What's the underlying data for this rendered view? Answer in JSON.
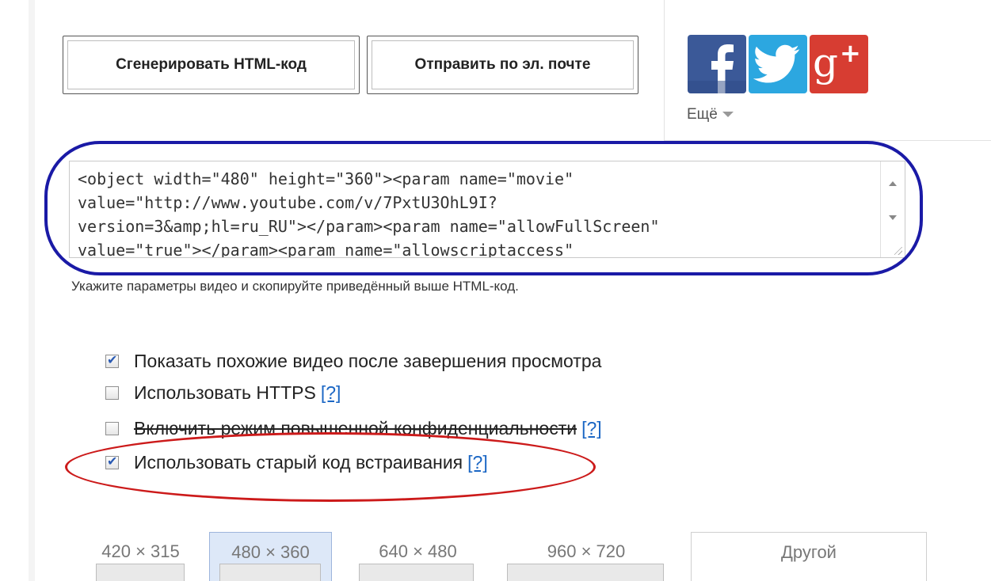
{
  "buttons": {
    "generate": "Сгенерировать HTML-код",
    "email": "Отправить по эл. почте"
  },
  "social": {
    "facebook": "facebook-icon",
    "twitter": "twitter-icon",
    "googleplus": "google-plus-icon",
    "more": "Ещё"
  },
  "code": {
    "line1_a": "<object width=\"480\" height=\"360\"><param name=\"movie\"",
    "line2": "value=\"http://www.youtube.com/v/7PxtU3OhL9I?",
    "line3": "version=3&amp;hl=ru_RU\"></param><param name=\"allowFullScreen\"",
    "line4": "value=\"true\"></param><param name=\"allowscriptaccess\""
  },
  "hint": "Укажите параметры видео и скопируйте приведённый выше HTML-код.",
  "options": [
    {
      "label": "Показать похожие видео после завершения просмотра",
      "checked": true
    },
    {
      "label": "Использовать HTTPS",
      "help": "[?]",
      "checked": false
    },
    {
      "label": "Включить режим повышенной конфиденциальности",
      "help": "[?]",
      "checked": false
    },
    {
      "label": "Использовать старый код встраивания",
      "help": "[?]",
      "checked": true
    }
  ],
  "sizes": [
    {
      "label": "420 × 315"
    },
    {
      "label": "480 × 360",
      "selected": true
    },
    {
      "label": "640 × 480"
    },
    {
      "label": "960 × 720"
    },
    {
      "label": "Другой"
    }
  ],
  "colors": {
    "blue_highlight": "#1a1aa6",
    "red_highlight": "#cc1a1a",
    "link": "#1a66c4"
  }
}
